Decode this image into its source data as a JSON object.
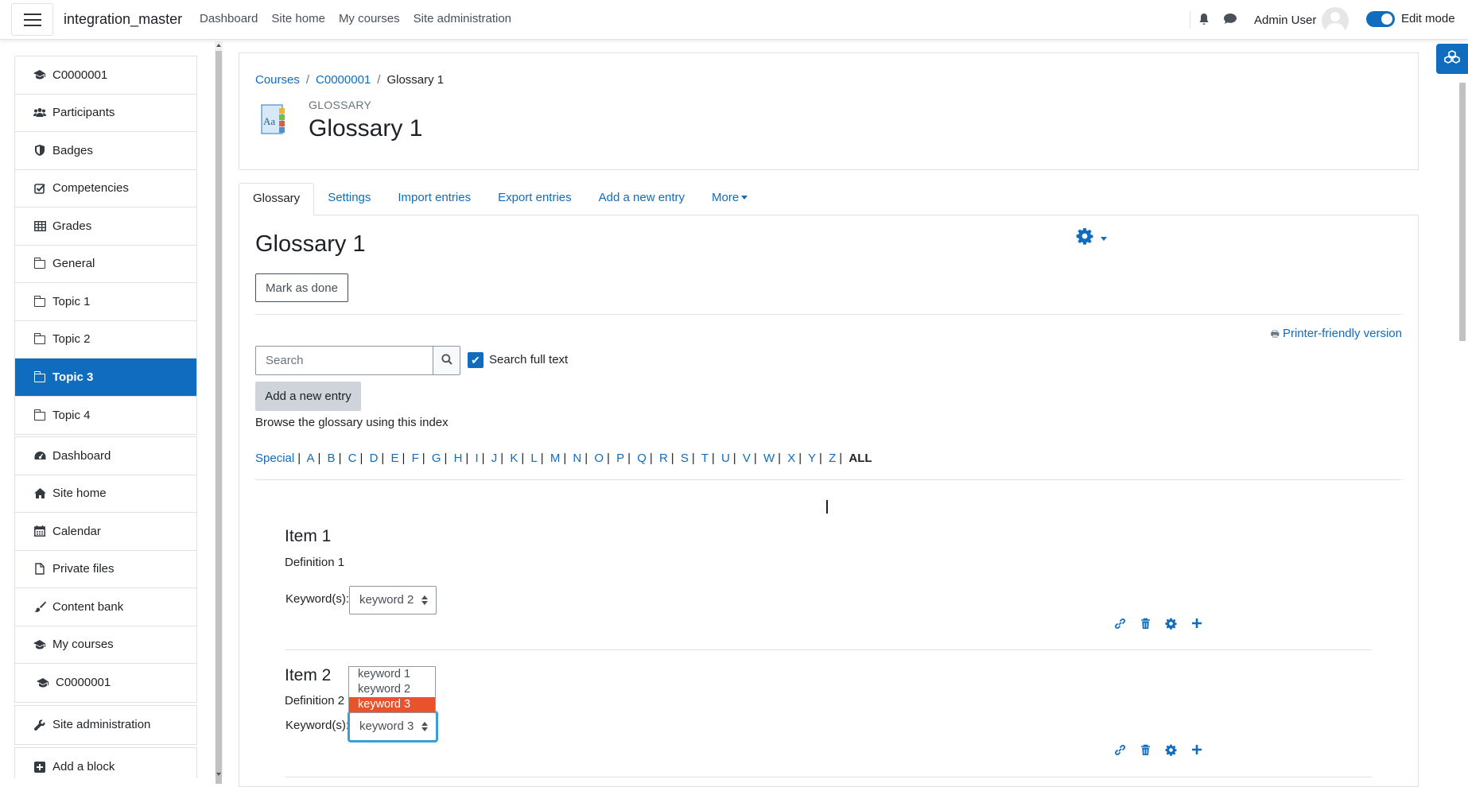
{
  "navbar": {
    "site_name": "integration_master",
    "links": [
      "Dashboard",
      "Site home",
      "My courses",
      "Site administration"
    ],
    "user_name": "Admin User",
    "edit_mode_label": "Edit mode",
    "edit_mode_on": true
  },
  "sidebar": {
    "course_items": [
      {
        "icon": "graduation-cap-icon",
        "label": "C0000001"
      },
      {
        "icon": "users-icon",
        "label": "Participants"
      },
      {
        "icon": "shield-icon",
        "label": "Badges"
      },
      {
        "icon": "check-square-icon",
        "label": "Competencies"
      },
      {
        "icon": "table-icon",
        "label": "Grades"
      },
      {
        "icon": "folder-icon",
        "label": "General"
      },
      {
        "icon": "folder-icon",
        "label": "Topic 1"
      },
      {
        "icon": "folder-icon",
        "label": "Topic 2"
      },
      {
        "icon": "folder-icon",
        "label": "Topic 3",
        "active": true
      },
      {
        "icon": "folder-icon",
        "label": "Topic 4"
      }
    ],
    "site_items": [
      {
        "icon": "dashboard-icon",
        "label": "Dashboard"
      },
      {
        "icon": "home-icon",
        "label": "Site home"
      },
      {
        "icon": "calendar-icon",
        "label": "Calendar"
      },
      {
        "icon": "file-icon",
        "label": "Private files"
      },
      {
        "icon": "brush-icon",
        "label": "Content bank"
      },
      {
        "icon": "graduation-cap-icon",
        "label": "My courses"
      },
      {
        "icon": "graduation-cap-icon",
        "label": "C0000001"
      }
    ],
    "admin_item": {
      "icon": "wrench-icon",
      "label": "Site administration"
    },
    "add_block": {
      "icon": "plus-square-icon",
      "label": "Add a block"
    }
  },
  "header": {
    "breadcrumb": [
      "Courses",
      "C0000001",
      "Glossary 1"
    ],
    "module_label": "GLOSSARY",
    "title": "Glossary 1"
  },
  "tabs": [
    {
      "label": "Glossary",
      "active": true
    },
    {
      "label": "Settings"
    },
    {
      "label": "Import entries"
    },
    {
      "label": "Export entries"
    },
    {
      "label": "Add a new entry"
    },
    {
      "label": "More"
    }
  ],
  "main": {
    "title": "Glossary 1",
    "mark_done_label": "Mark as done",
    "printer_label": "Printer-friendly version",
    "search_placeholder": "Search",
    "search_full_text_label": "Search full text",
    "search_full_text_checked": true,
    "add_entry_label": "Add a new entry",
    "browse_label": "Browse the glossary using this index",
    "alphabet": [
      "Special",
      "A",
      "B",
      "C",
      "D",
      "E",
      "F",
      "G",
      "H",
      "I",
      "J",
      "K",
      "L",
      "M",
      "N",
      "O",
      "P",
      "Q",
      "R",
      "S",
      "T",
      "U",
      "V",
      "W",
      "X",
      "Y",
      "Z"
    ],
    "alphabet_current": "ALL"
  },
  "entries": [
    {
      "title": "Item 1",
      "definition": "Definition 1",
      "keywords_label": "Keyword(s):",
      "selected_keyword": "keyword 2"
    },
    {
      "title": "Item 2",
      "definition": "Definition 2",
      "keywords_label": "Keyword(s):",
      "selected_keyword": "keyword 3"
    }
  ],
  "open_dropdown": {
    "options": [
      "keyword 1",
      "keyword 2",
      "keyword 3"
    ],
    "highlighted": "keyword 3"
  },
  "colors": {
    "brand": "#0f6cbf",
    "dropdown_highlight": "#e8532b",
    "focus_ring": "#3b9fd6"
  }
}
